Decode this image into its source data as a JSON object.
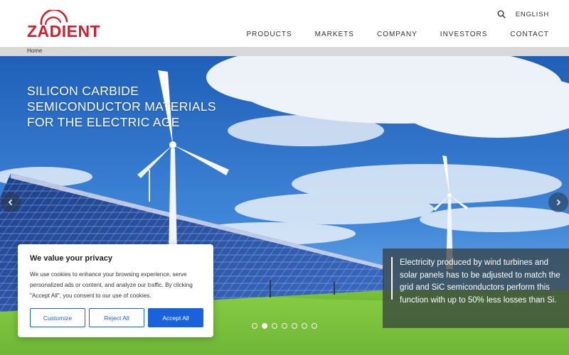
{
  "brand": {
    "name": "ZADIENT",
    "color": "#d0202e",
    "logo_icon": "sun-arc-icon"
  },
  "header": {
    "language": "ENGLISH",
    "nav": [
      "PRODUCTS",
      "MARKETS",
      "COMPANY",
      "INVESTORS",
      "CONTACT"
    ]
  },
  "breadcrumb": {
    "home": "Home"
  },
  "hero": {
    "title_lines": [
      "SILICON CARBIDE",
      "SEMICONDUCTOR MATERIALS",
      "FOR THE ELECTRIC AGE"
    ],
    "caption": "Electricity produced by wind turbines and solar panels has to be adjusted to match the grid and SiC semiconductors perform this function with up to 50% less losses than Si.",
    "slides_total": 7,
    "active_slide": 2
  },
  "cookie": {
    "title": "We value your privacy",
    "body": "We use cookies to enhance your browsing experience, serve personalized ads or content, and analyze our traffic. By clicking \"Accept All\", you consent to our use of cookies.",
    "customize": "Customize",
    "reject": "Reject All",
    "accept": "Accept All",
    "accent": "#1863dc"
  }
}
